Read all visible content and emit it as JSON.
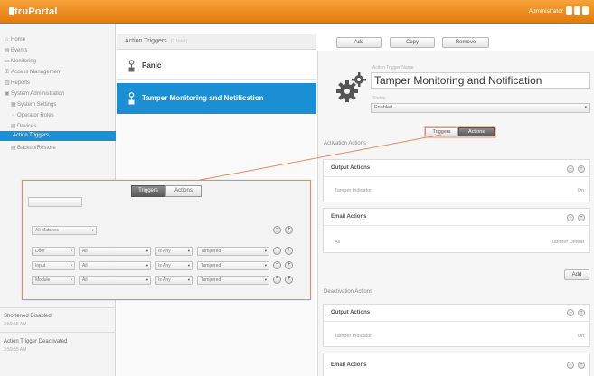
{
  "header": {
    "logo_text": "truPortal",
    "user_label": "Administrator"
  },
  "sidebar": {
    "items": [
      {
        "label": "Home",
        "glyph": "⌂"
      },
      {
        "label": "Events",
        "glyph": "▤"
      },
      {
        "label": "Monitoring",
        "glyph": "▭"
      },
      {
        "label": "Access Management",
        "glyph": "⚿"
      },
      {
        "label": "Reports",
        "glyph": "▥"
      },
      {
        "label": "System Administration",
        "glyph": "▣"
      },
      {
        "label": "System Settings",
        "glyph": "▦"
      },
      {
        "label": "Operator Roles",
        "glyph": "◦"
      },
      {
        "label": "Devices",
        "glyph": "▤"
      }
    ],
    "active_item": "Action Triggers",
    "after_active": "Backup/Restore",
    "bottom": [
      {
        "title": "Shortened Disabled",
        "time": "3:59:55 AM"
      },
      {
        "title": "Action Trigger Deactivated",
        "time": "3:59:55 AM"
      }
    ]
  },
  "toolbar": {
    "title": "Action Triggers",
    "count_hint": "(2 total)",
    "buttons": [
      "Add",
      "Copy",
      "Remove"
    ]
  },
  "triggers": [
    {
      "name": "Panic",
      "selected": false
    },
    {
      "name": "Tamper Monitoring and Notification",
      "selected": true
    }
  ],
  "detail": {
    "name_label": "Action Trigger Name",
    "name_value": "Tamper Monitoring and Notification",
    "status_label": "Status",
    "status_value": "Enabled",
    "toggle": [
      "Triggers",
      "Actions"
    ],
    "activation_title": "Activation Actions",
    "deactivation_title": "Deactivation Actions",
    "boxes": [
      {
        "title": "Output Actions",
        "row_label": "Tamper Indicator",
        "row_value": "On"
      },
      {
        "title": "Email Actions",
        "row_label": "All",
        "row_value": "Tamper Defeat"
      },
      {
        "title": "Output Actions",
        "row_label": "Tamper Indicator",
        "row_value": "Off"
      },
      {
        "title": "Email Actions",
        "row_label": "",
        "row_value": ""
      }
    ],
    "add_label": "Add"
  },
  "zoom": {
    "toggle": [
      "Triggers",
      "Actions"
    ],
    "top_field": "",
    "match": "All Matches",
    "rows": [
      {
        "a": "Door",
        "b": "All",
        "c": "Is Any",
        "d": "Tampered"
      },
      {
        "a": "Input",
        "b": "All",
        "c": "Is Any",
        "d": "Tampered"
      },
      {
        "a": "Module",
        "b": "All",
        "c": "Is Any",
        "d": "Tampered"
      }
    ]
  },
  "colors": {
    "header": "#e8890f",
    "selection": "#1a8fd4",
    "callout": "#e88866"
  }
}
